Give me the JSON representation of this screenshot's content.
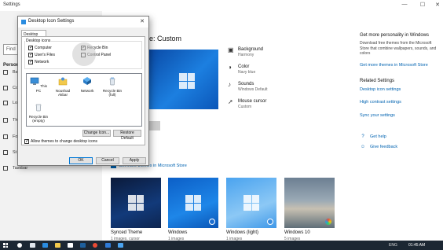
{
  "window": {
    "title": "Settings",
    "controls": [
      "—",
      "☐",
      "✕"
    ]
  },
  "nav": {
    "search_placeholder": "Find",
    "header": "Person",
    "items": [
      {
        "label": "Ba",
        "icon": "background-icon"
      },
      {
        "label": "Co",
        "icon": "colors-icon"
      },
      {
        "label": "Lo",
        "icon": "lockscreen-icon"
      },
      {
        "label": "Th",
        "icon": "themes-icon"
      },
      {
        "label": "Fo",
        "icon": "fonts-icon"
      },
      {
        "label": "St",
        "icon": "start-icon"
      },
      {
        "label": "Taskbar",
        "icon": "taskbar-icon"
      }
    ]
  },
  "main": {
    "title": "e: Custom",
    "properties": [
      {
        "name": "Background",
        "value": "Harmony",
        "icon": "background-icon"
      },
      {
        "name": "Color",
        "value": "Navy blue",
        "icon": "palette-icon"
      },
      {
        "name": "Sounds",
        "value": "Windows Default",
        "icon": "speaker-icon"
      },
      {
        "name": "Mouse cursor",
        "value": "Custom",
        "icon": "cursor-icon"
      }
    ],
    "themes_heading": "e",
    "store_link": "Get more themes in Microsoft Store",
    "themes": [
      {
        "name": "Synced Theme",
        "sub": "1 images, cursor",
        "style": "dark"
      },
      {
        "name": "Windows",
        "sub": "1 images",
        "style": "blue"
      },
      {
        "name": "Windows (light)",
        "sub": "1 images",
        "style": "light"
      },
      {
        "name": "Windows 10",
        "sub": "5 images",
        "style": "beach"
      }
    ]
  },
  "right": {
    "heading": "Get more personality in Windows",
    "description": "Download free themes from the Microsoft Store that combine wallpapers, sounds, and colors",
    "store_link": "Get more themes in Microsoft Store",
    "related_heading": "Related Settings",
    "links": [
      "Desktop icon settings",
      "High contrast settings",
      "Sync your settings"
    ],
    "help": [
      {
        "label": "Get help",
        "icon": "help-icon"
      },
      {
        "label": "Give feedback",
        "icon": "feedback-icon"
      }
    ]
  },
  "dialog": {
    "title": "Desktop Icon Settings",
    "close": "✕",
    "tab": "Desktop Icons",
    "group_label": "Desktop icons",
    "checkboxes": [
      {
        "label": "Computer",
        "checked": true
      },
      {
        "label": "User's Files",
        "checked": true
      },
      {
        "label": "Network",
        "checked": true
      },
      {
        "label": "Recycle Bin",
        "checked": true
      },
      {
        "label": "Control Panel",
        "checked": false
      }
    ],
    "icons": [
      {
        "label": "This PC",
        "icon": "computer-icon"
      },
      {
        "label": "Noushad Akbar",
        "icon": "user-folder-icon"
      },
      {
        "label": "Network",
        "icon": "network-icon"
      },
      {
        "label": "Recycle Bin (full)",
        "icon": "recycle-bin-full-icon"
      },
      {
        "label": "Recycle Bin (empty)",
        "icon": "recycle-bin-empty-icon"
      }
    ],
    "change_icon": "Change Icon...",
    "restore_default": "Restore Default",
    "allow_themes": "Allow themes to change desktop icons",
    "allow_themes_checked": true,
    "ok": "OK",
    "cancel": "Cancel",
    "apply": "Apply"
  },
  "taskbar": {
    "clock": "01:45 AM",
    "tray": "ENG"
  },
  "colors": {
    "accent": "#0063b1",
    "dialog_bg": "#f0f0f0",
    "taskbar": "#1c2733"
  }
}
